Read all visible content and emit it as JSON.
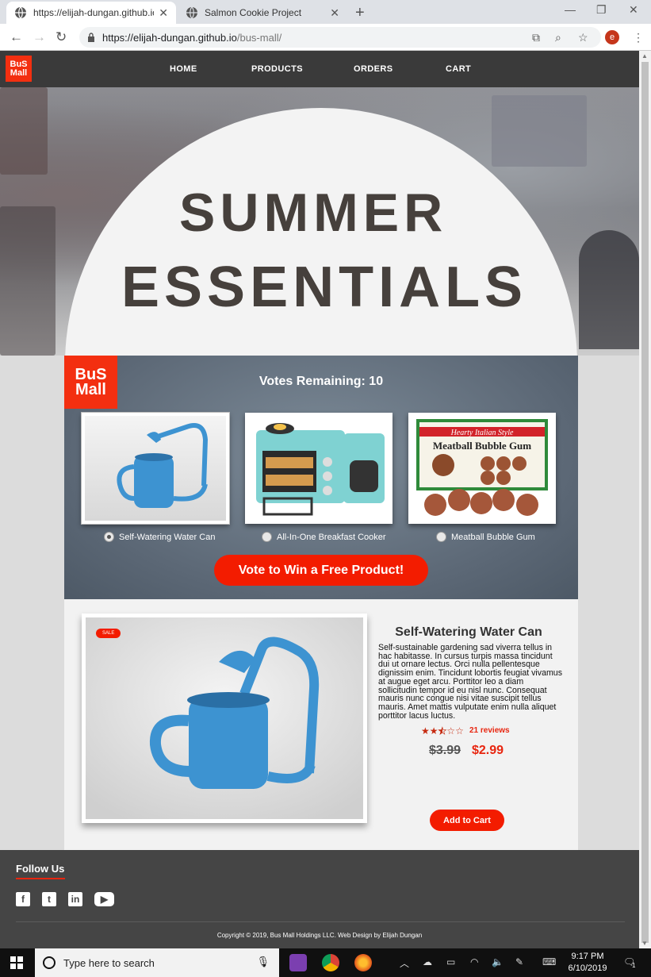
{
  "browser": {
    "tabs": [
      {
        "title": "https://elijah-dungan.github.io/b",
        "active": true
      },
      {
        "title": "Salmon Cookie Project",
        "active": false
      }
    ],
    "new_tab": "+",
    "url_host": "https://elijah-dungan.github.io",
    "url_path": "/bus-mall/",
    "profile_initial": "e"
  },
  "site": {
    "logo_line1": "BuS",
    "logo_line2": "Mall",
    "nav": [
      "HOME",
      "PRODUCTS",
      "ORDERS",
      "CART"
    ],
    "hero_line1": "SUMMER",
    "hero_line2": "ESSENTIALS",
    "votes_remaining": "Votes Remaining: 10",
    "options": [
      {
        "label": "Self-Watering Water Can",
        "selected": true
      },
      {
        "label": "All-In-One Breakfast Cooker",
        "selected": false
      },
      {
        "label": "Meatball Bubble Gum",
        "selected": false
      }
    ],
    "gum_box": {
      "brand": "Hearty Italian Style",
      "name": "Meatball Bubble Gum"
    },
    "vote_button": "Vote to Win a Free Product!",
    "product": {
      "badge": "SALE",
      "name": "Self-Watering Water Can",
      "description": "Self-sustainable gardening sad viverra tellus in hac habitasse. In cursus turpis massa tincidunt dui ut ornare lectus. Orci nulla pellentesque dignissim enim. Tincidunt lobortis feugiat vivamus at augue eget arcu. Porttitor leo a diam sollicitudin tempor id eu nisl nunc. Consequat mauris nunc congue nisi vitae suscipit tellus mauris. Amet mattis vulputate enim nulla aliquet porttitor lacus luctus.",
      "rating": 2.5,
      "rating_max": 5,
      "reviews": "21 reviews",
      "old_price": "$3.99",
      "new_price": "$2.99",
      "cart_button": "Add to Cart"
    },
    "footer": {
      "follow": "Follow Us",
      "social": [
        "facebook-icon",
        "twitter-icon",
        "linkedin-icon",
        "youtube-icon"
      ],
      "copyright": "Copyright © 2019, Bus Mall Holdings LLC. Web Design by Elijah Dungan"
    }
  },
  "taskbar": {
    "search_placeholder": "Type here to search",
    "time": "9:17 PM",
    "date": "6/10/2019",
    "notification_count": "1"
  },
  "colors": {
    "brand_red": "#f31c00",
    "nav_dark": "#3a3a3a",
    "panel_slate": "#5b6775"
  }
}
